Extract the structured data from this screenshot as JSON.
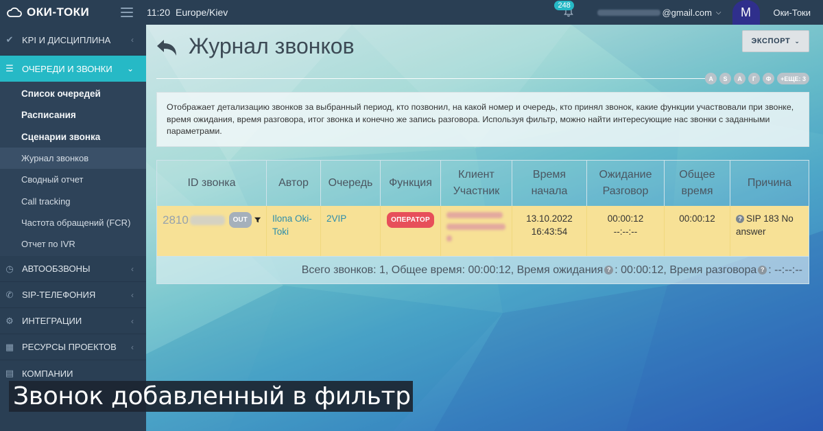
{
  "brand": {
    "name": "ОКИ-ТОКИ"
  },
  "topbar": {
    "time": "11:20",
    "timezone": "Europe/Kiev",
    "notifications_count": "248",
    "email_suffix": "@gmail.com",
    "avatar_letter": "M",
    "user_name": "Оки-Токи"
  },
  "sidebar": {
    "items": [
      {
        "label": "KPI и дисциплина",
        "icon": "check-icon"
      },
      {
        "label": "Очереди и звонки",
        "icon": "list-icon"
      },
      {
        "label": "Автообзвоны",
        "icon": "clock-icon"
      },
      {
        "label": "SIP-телефония",
        "icon": "phone-icon"
      },
      {
        "label": "Интеграции",
        "icon": "cogs-icon"
      },
      {
        "label": "Ресурсы проектов",
        "icon": "grid-icon"
      },
      {
        "label": "Компании",
        "icon": "chart-icon"
      }
    ],
    "subitems": [
      {
        "label": "Список очередей"
      },
      {
        "label": "Расписания"
      },
      {
        "label": "Сценарии звонка"
      },
      {
        "label": "Журнал звонков"
      },
      {
        "label": "Сводный отчет"
      },
      {
        "label": "Call tracking"
      },
      {
        "label": "Частота обращений (FCR)"
      },
      {
        "label": "Отчет по IVR"
      }
    ]
  },
  "page": {
    "title": "Журнал звонков",
    "export_label": "ЭКСПОРТ",
    "letters": [
      "A",
      "S",
      "A",
      "Г",
      "Ф"
    ],
    "more_label": "+ЕЩЕ: 3",
    "description": "Отображает детализацию звонков за выбранный период, кто позвонил, на какой номер и очередь, кто принял звонок, какие функции участвовали при звонке, время ожидания, время разговора, итог звонка и конечно же запись разговора. Используя фильтр, можно найти интересующие нас звонки с заданными параметрами."
  },
  "table": {
    "headers": {
      "id": "ID звонка",
      "author": "Автор",
      "queue": "Очередь",
      "function": "Функция",
      "client_line1": "Клиент",
      "client_line2": "Участник",
      "start_line1": "Время",
      "start_line2": "начала",
      "wait_line1": "Ожидание",
      "wait_line2": "Разговор",
      "total_line1": "Общее",
      "total_line2": "время",
      "reason": "Причина"
    },
    "row": {
      "id_prefix": "2810",
      "direction": "OUT",
      "author": "Ilona Oki-Toki",
      "queue": "2VIP",
      "function": "ОПЕРАТОР",
      "date": "13.10.2022",
      "time": "16:43:54",
      "wait": "00:00:12",
      "talk": "--:--:--",
      "total": "00:00:12",
      "reason": "SIP 183 No answer"
    },
    "footer": {
      "part1": "Всего звонков: 1, Общее время: 00:00:12, Время ожидания",
      "part2": ": 00:00:12, Время разговора",
      "part3": ": --:--:--"
    }
  },
  "caption": "Звонок добавленный в фильтр",
  "colors": {
    "sidebar_bg": "#2a3f54",
    "accent": "#26b9c6",
    "row_highlight": "#f7e196",
    "operator_badge": "#e74f5a"
  }
}
